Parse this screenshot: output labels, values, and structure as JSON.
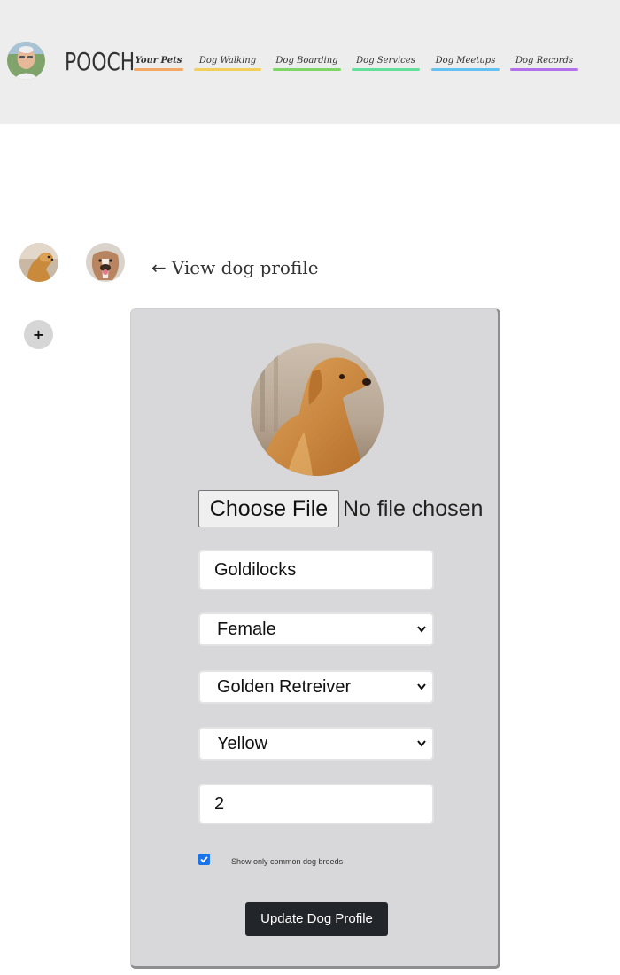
{
  "header": {
    "brand": "POOCH",
    "nav": [
      {
        "label": "Your Pets",
        "color": "#f2a765"
      },
      {
        "label": "Dog Walking",
        "color": "#f2cf5b"
      },
      {
        "label": "Dog Boarding",
        "color": "#7fd667"
      },
      {
        "label": "Dog Services",
        "color": "#63de9b"
      },
      {
        "label": "Dog Meetups",
        "color": "#63c2f2"
      },
      {
        "label": "Dog Records",
        "color": "#b071ea"
      }
    ]
  },
  "pets": {
    "add_label": "+",
    "view_profile_arrow": "←",
    "view_profile_label": "View dog profile"
  },
  "form": {
    "file_button_label": "Choose File",
    "file_status": "No file chosen",
    "name_value": "Goldilocks",
    "sex_value": "Female",
    "breed_value": "Golden Retreiver",
    "color_value": "Yellow",
    "age_value": "2",
    "common_breeds_checked": true,
    "common_breeds_label": "Show only common dog breeds",
    "submit_label": "Update Dog Profile"
  },
  "colors": {
    "header_bg": "#ededed",
    "card_bg": "#d8d8da",
    "accent": "#1a73e8",
    "button_dark": "#22252a"
  }
}
